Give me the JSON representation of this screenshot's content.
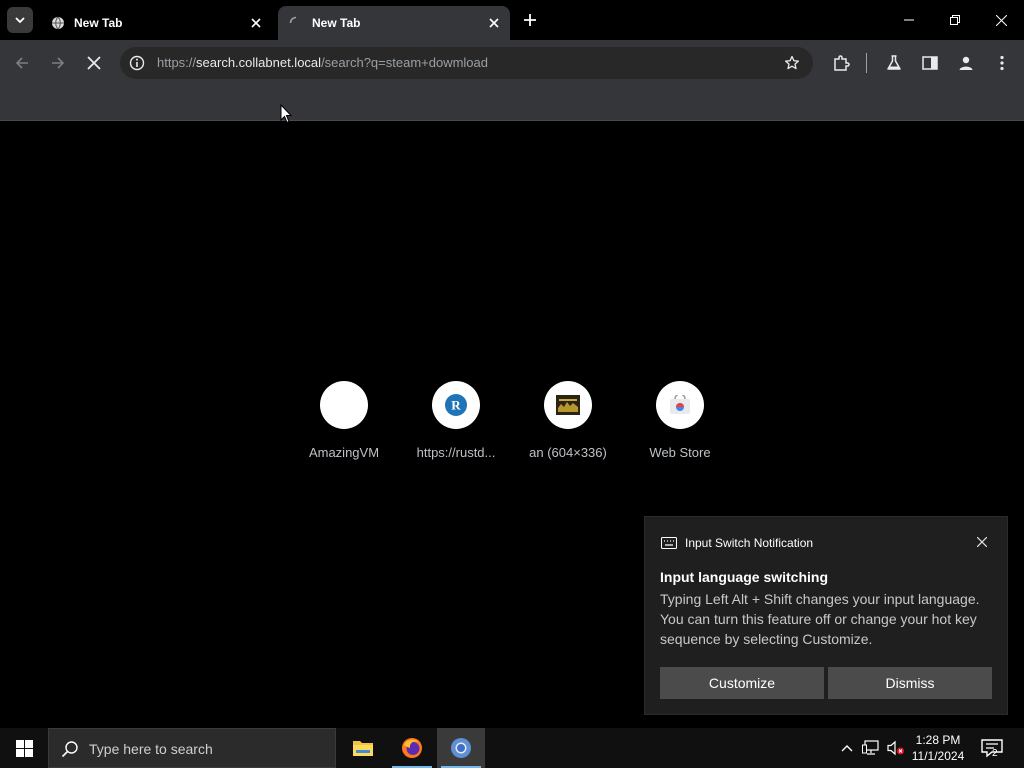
{
  "tabs": [
    {
      "title": "New Tab",
      "state": "inactive"
    },
    {
      "title": "New Tab",
      "state": "loading"
    }
  ],
  "omnibox": {
    "scheme": "https://",
    "host": "search.collabnet.local",
    "path": "/search?q=steam+dowmload"
  },
  "shortcuts": [
    {
      "label": "AmazingVM",
      "icon": "blank-favicon"
    },
    {
      "label": "https://rustd...",
      "icon": "letter-r-favicon",
      "letter": "R"
    },
    {
      "label": "an (604×336)",
      "icon": "thumbnail-favicon"
    },
    {
      "label": "Web Store",
      "icon": "web-store-icon"
    }
  ],
  "notification": {
    "app": "Input Switch Notification",
    "title": "Input language switching",
    "body": "Typing Left Alt + Shift changes your input language. You can turn this feature off or change your hot key sequence by selecting Customize.",
    "customize": "Customize",
    "dismiss": "Dismiss"
  },
  "taskbar": {
    "search_placeholder": "Type here to search",
    "time": "1:28 PM",
    "date": "11/1/2024",
    "notification_count": "2"
  },
  "colors": {
    "accent": "#76b9ed",
    "toolbar": "#35363a",
    "omnibox": "#282828",
    "toast": "#1f1f1f"
  }
}
